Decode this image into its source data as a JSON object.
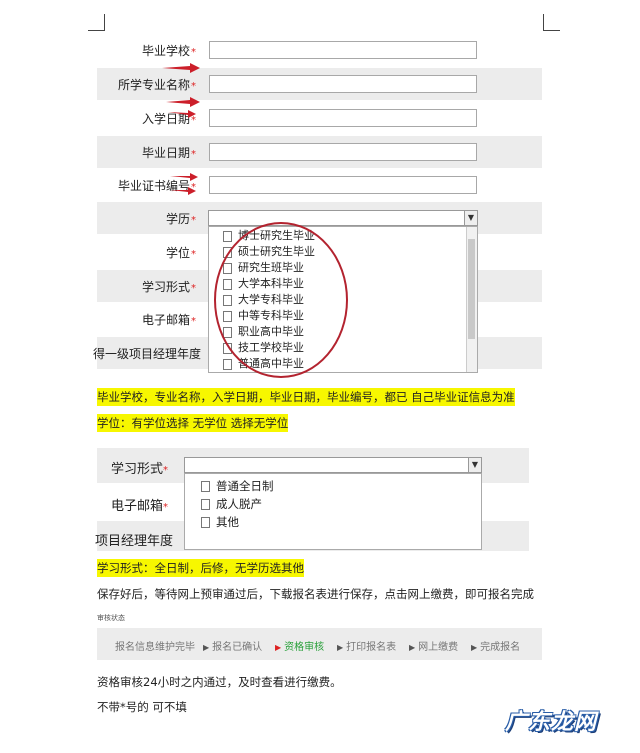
{
  "form1": {
    "rows": [
      {
        "label": "毕业学校",
        "req": "*"
      },
      {
        "label": "所学专业名称",
        "req": "*"
      },
      {
        "label": "入学日期",
        "req": "*"
      },
      {
        "label": "毕业日期",
        "req": "*"
      },
      {
        "label": "毕业证书编号",
        "req": "*"
      }
    ],
    "education": {
      "label": "学历",
      "req": "*"
    },
    "degree": {
      "label": "学位",
      "req": "*"
    },
    "study_mode": {
      "label": "学习形式",
      "req": "*"
    },
    "email": {
      "label": "电子邮箱",
      "req": "*"
    },
    "pm_year": {
      "label": "得一级项目经理年度"
    },
    "education_options": [
      "博士研究生毕业",
      "硕士研究生毕业",
      "研究生班毕业",
      "大学本科毕业",
      "大学专科毕业",
      "中等专科毕业",
      "职业高中毕业",
      "技工学校毕业",
      "普通高中毕业"
    ]
  },
  "note1": "毕业学校，专业名称，入学日期，毕业日期，毕业编号，都已 自己毕业证信息为准",
  "note2": "学位：有学位选择 无学位 选择无学位",
  "form2": {
    "study_mode": {
      "label": "学习形式",
      "req": "*"
    },
    "email": {
      "label": "电子邮箱",
      "req": "*"
    },
    "pm_year": {
      "label": "项目经理年度"
    },
    "options": [
      "普通全日制",
      "成人脱产",
      "其他"
    ]
  },
  "note3": "学习形式：全日制，后修，无学历选其他",
  "note4": "保存好后，等待网上预审通过后，下载报名表进行保存，点击网上缴费，即可报名完成",
  "small_label": "审核状态",
  "steps": [
    {
      "label": "报名信息维护完毕",
      "active": false
    },
    {
      "label": "报名已确认",
      "active": false
    },
    {
      "label": "资格审核",
      "active": true
    },
    {
      "label": "打印报名表",
      "active": false
    },
    {
      "label": "网上缴费",
      "active": false
    },
    {
      "label": "完成报名",
      "active": false
    }
  ],
  "note5": "资格审核24小时之内通过，及时查看进行缴费。",
  "note6": "不带*号的 可不填",
  "watermark": "广东龙网",
  "colors": {
    "highlight": "#f7f700",
    "required": "#dd2222",
    "arrow": "#cc1f2a",
    "active_step": "#29a03a"
  }
}
